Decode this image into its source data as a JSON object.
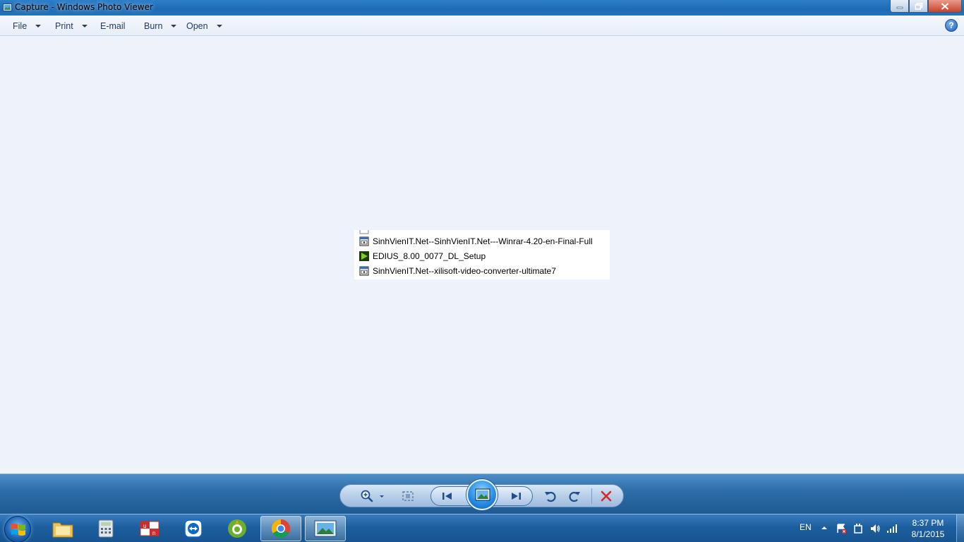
{
  "window": {
    "title": "Capture - Windows Photo Viewer"
  },
  "menu": {
    "file": "File",
    "print": "Print",
    "email": "E-mail",
    "burn": "Burn",
    "open": "Open"
  },
  "photo": {
    "items": [
      {
        "name": "SinhVienIT.Net--SinhVienIT.Net---Winrar-4.20-en-Final-Full",
        "icon": "installer-icon"
      },
      {
        "name": "EDIUS_8.00_0077_DL_Setup",
        "icon": "edius-play-icon"
      },
      {
        "name": "SinhVienIT.Net--xilisoft-video-converter-ultimate7",
        "icon": "installer-icon"
      }
    ]
  },
  "controls": {
    "buttons": [
      "zoom-icon",
      "actual-size-icon",
      "previous-icon",
      "slideshow-icon",
      "next-icon",
      "rotate-counterclockwise-icon",
      "rotate-clockwise-icon",
      "delete-icon"
    ]
  },
  "taskbar": {
    "apps": [
      "file-explorer-icon",
      "calculator-icon",
      "unikey-icon",
      "teamviewer-icon",
      "coc-coc-icon",
      "chrome-icon",
      "photo-viewer-icon"
    ],
    "tray": {
      "language": "EN",
      "time": "8:37 PM",
      "date": "8/1/2015"
    }
  },
  "colors": {
    "viewer_background": "#eef3fb",
    "taskbar": "#1c5f9e",
    "delete_red": "#d42a2a"
  }
}
